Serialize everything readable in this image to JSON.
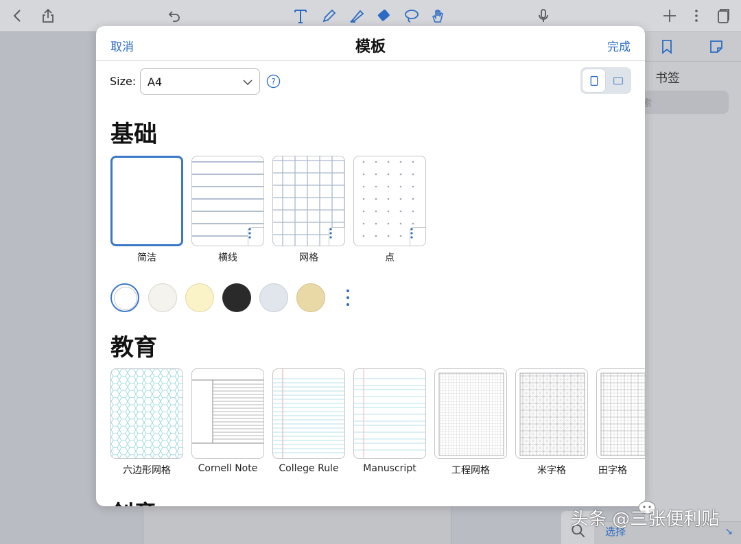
{
  "modal": {
    "cancel_label": "取消",
    "title": "模板",
    "done_label": "完成",
    "size_label": "Size:",
    "size_value": "A4"
  },
  "sections": {
    "basic": {
      "title": "基础",
      "templates": [
        "简洁",
        "横线",
        "网格",
        "点"
      ]
    },
    "education": {
      "title": "教育",
      "templates": [
        "六边形网格",
        "Cornell Note",
        "College Rule",
        "Manuscript",
        "工程网格",
        "米字格",
        "田字格"
      ]
    },
    "creative": {
      "title": "创意"
    }
  },
  "swatches": [
    "#ffffff",
    "#f5f3ee",
    "#fbf3c8",
    "#2a2a2a",
    "#e1e5ec",
    "#e9d9a6"
  ],
  "sidebar": {
    "title": "书签",
    "search_text": "索"
  },
  "bottom": {
    "select_label": "选择"
  },
  "watermark": "头条 @三张便利贴",
  "colors": {
    "accent": "#2a6cc4",
    "selected_border": "#3a78c8"
  }
}
